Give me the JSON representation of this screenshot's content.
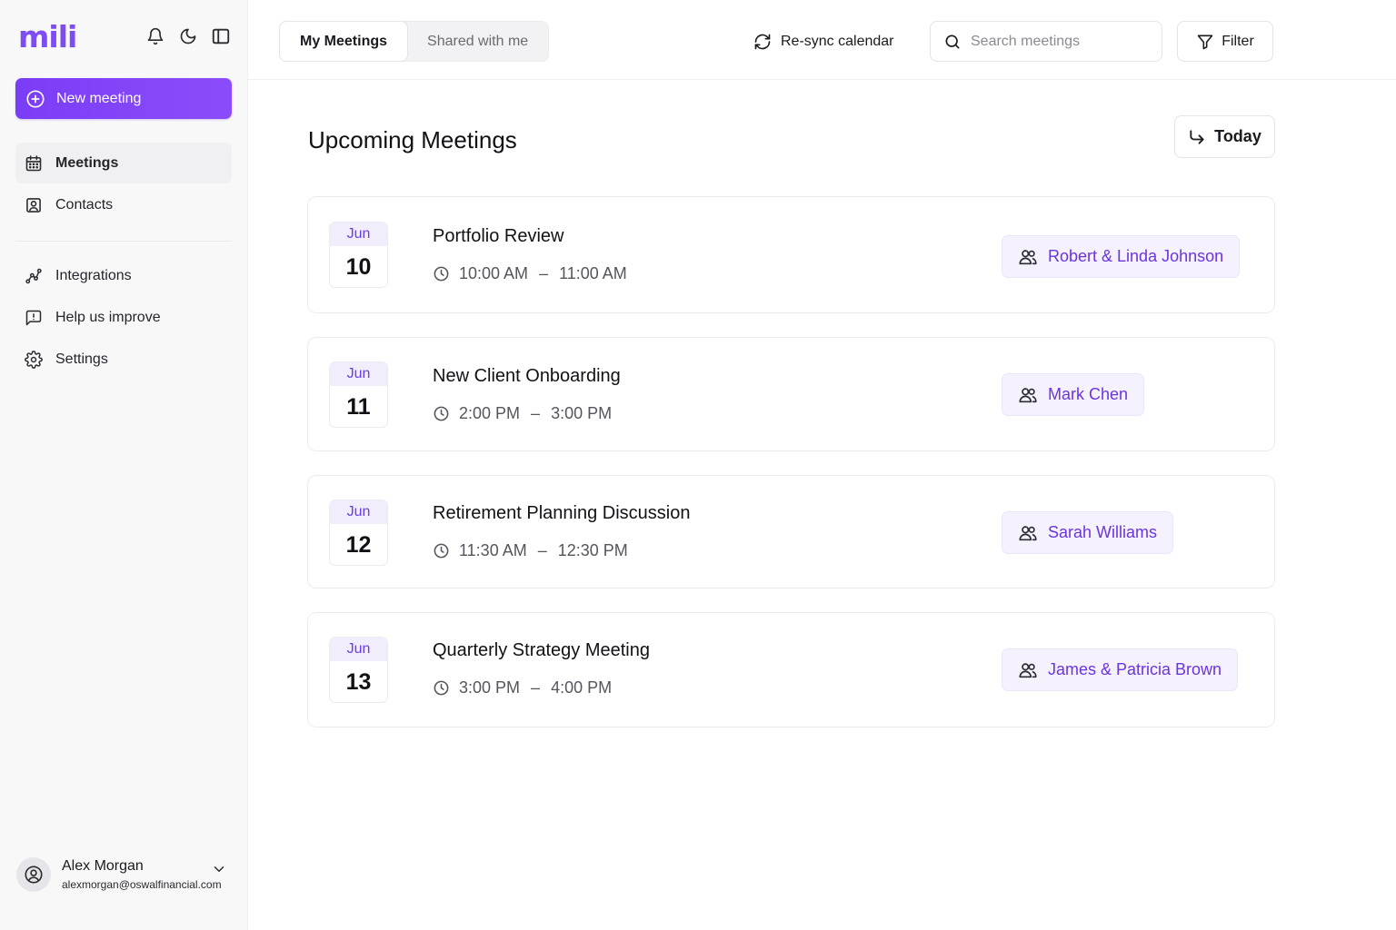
{
  "brand": {
    "logo": "mili",
    "accent": "#7d4cf3"
  },
  "sidebar": {
    "new_meeting_label": "New meeting",
    "items": [
      {
        "label": "Meetings",
        "icon": "calendar-icon",
        "active": true
      },
      {
        "label": "Contacts",
        "icon": "contact-card-icon",
        "active": false
      },
      {
        "label": "Integrations",
        "icon": "integrations-icon",
        "active": false
      },
      {
        "label": "Help us improve",
        "icon": "feedback-icon",
        "active": false
      },
      {
        "label": "Settings",
        "icon": "gear-icon",
        "active": false
      }
    ],
    "header_icons": [
      "bell-icon",
      "moon-icon",
      "sidebar-toggle-icon"
    ]
  },
  "user": {
    "name": "Alex Morgan",
    "email": "alexmorgan@oswalfinancial.com"
  },
  "topbar": {
    "tabs": [
      {
        "label": "My Meetings",
        "active": true
      },
      {
        "label": "Shared with me",
        "active": false
      }
    ],
    "resync_label": "Re-sync calendar",
    "search_placeholder": "Search meetings",
    "search_value": "",
    "filter_label": "Filter"
  },
  "main": {
    "title": "Upcoming Meetings",
    "today_label": "Today",
    "meetings": [
      {
        "month": "Jun",
        "day": "10",
        "title": "Portfolio Review",
        "start": "10:00 AM",
        "end": "11:00 AM",
        "attendees": "Robert & Linda Johnson"
      },
      {
        "month": "Jun",
        "day": "11",
        "title": "New Client Onboarding",
        "start": "2:00 PM",
        "end": "3:00 PM",
        "attendees": "Mark Chen"
      },
      {
        "month": "Jun",
        "day": "12",
        "title": "Retirement Planning Discussion",
        "start": "11:30 AM",
        "end": "12:30 PM",
        "attendees": "Sarah Williams"
      },
      {
        "month": "Jun",
        "day": "13",
        "title": "Quarterly Strategy Meeting",
        "start": "3:00 PM",
        "end": "4:00 PM",
        "attendees": "James & Patricia Brown"
      }
    ]
  }
}
